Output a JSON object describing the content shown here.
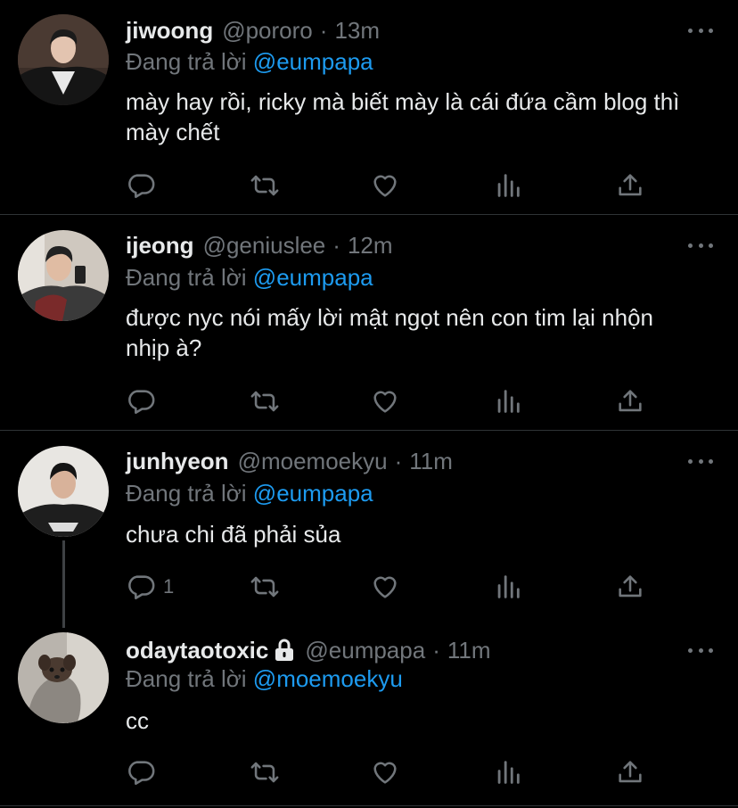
{
  "reply_prefix": "Đang trả lời",
  "tweets": [
    {
      "name": "jiwoong",
      "handle": "@pororo",
      "sep": "·",
      "time": "13m",
      "reply_to": "@eumpapa",
      "text": "mày hay rồi, ricky mà biết mày là cái đứa cầm blog thì mày chết",
      "reply_count": "",
      "avatar_icon": "avatar-man-black-jacket"
    },
    {
      "name": "ijeong",
      "handle": "@geniuslee",
      "sep": "·",
      "time": "12m",
      "reply_to": "@eumpapa",
      "text": "được nyc nói mấy lời mật ngọt nên con tim lại nhộn nhịp à?",
      "reply_count": "",
      "avatar_icon": "avatar-man-mirror-selfie"
    },
    {
      "name": "junhyeon",
      "handle": "@moemoekyu",
      "sep": "·",
      "time": "11m",
      "reply_to": "@eumpapa",
      "text": "chưa chi đã phải sủa",
      "reply_count": "1",
      "avatar_icon": "avatar-man-dark-shirt"
    },
    {
      "name": "odaytaotoxic",
      "handle": "@eumpapa",
      "sep": "·",
      "time": "11m",
      "reply_to": "@moemoekyu",
      "text": "cc",
      "reply_count": "",
      "avatar_icon": "avatar-small-dog"
    }
  ],
  "colors": {
    "background": "#000000",
    "text": "#e7e9ea",
    "secondary": "#71767b",
    "mention": "#1d9bf0",
    "divider": "#2f3336"
  }
}
